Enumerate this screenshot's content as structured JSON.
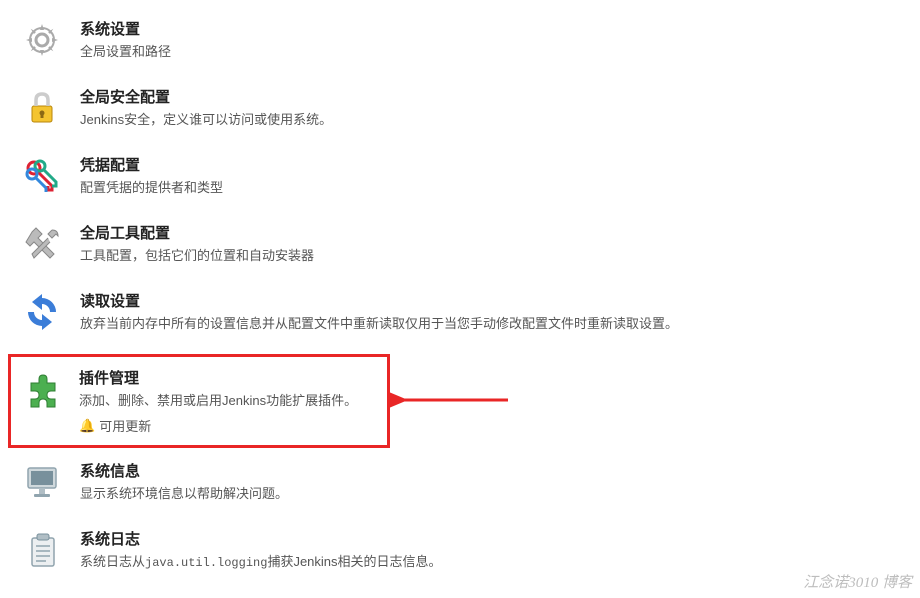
{
  "menu": {
    "items": [
      {
        "title": "系统设置",
        "desc": "全局设置和路径"
      },
      {
        "title": "全局安全配置",
        "desc": "Jenkins安全，定义谁可以访问或使用系统。"
      },
      {
        "title": "凭据配置",
        "desc": "配置凭据的提供者和类型"
      },
      {
        "title": "全局工具配置",
        "desc": "工具配置，包括它们的位置和自动安装器"
      },
      {
        "title": "读取设置",
        "desc": "放弃当前内存中所有的设置信息并从配置文件中重新读取仅用于当您手动修改配置文件时重新读取设置。"
      },
      {
        "title": "插件管理",
        "desc": "添加、删除、禁用或启用Jenkins功能扩展插件。",
        "update": "可用更新"
      },
      {
        "title": "系统信息",
        "desc": "显示系统环境信息以帮助解决问题。"
      },
      {
        "title": "系统日志",
        "desc_pre": "系统日志从",
        "desc_code": "java.util.logging",
        "desc_post": "捕获Jenkins相关的日志信息。"
      }
    ]
  },
  "watermark": "江念诺3010 博客"
}
